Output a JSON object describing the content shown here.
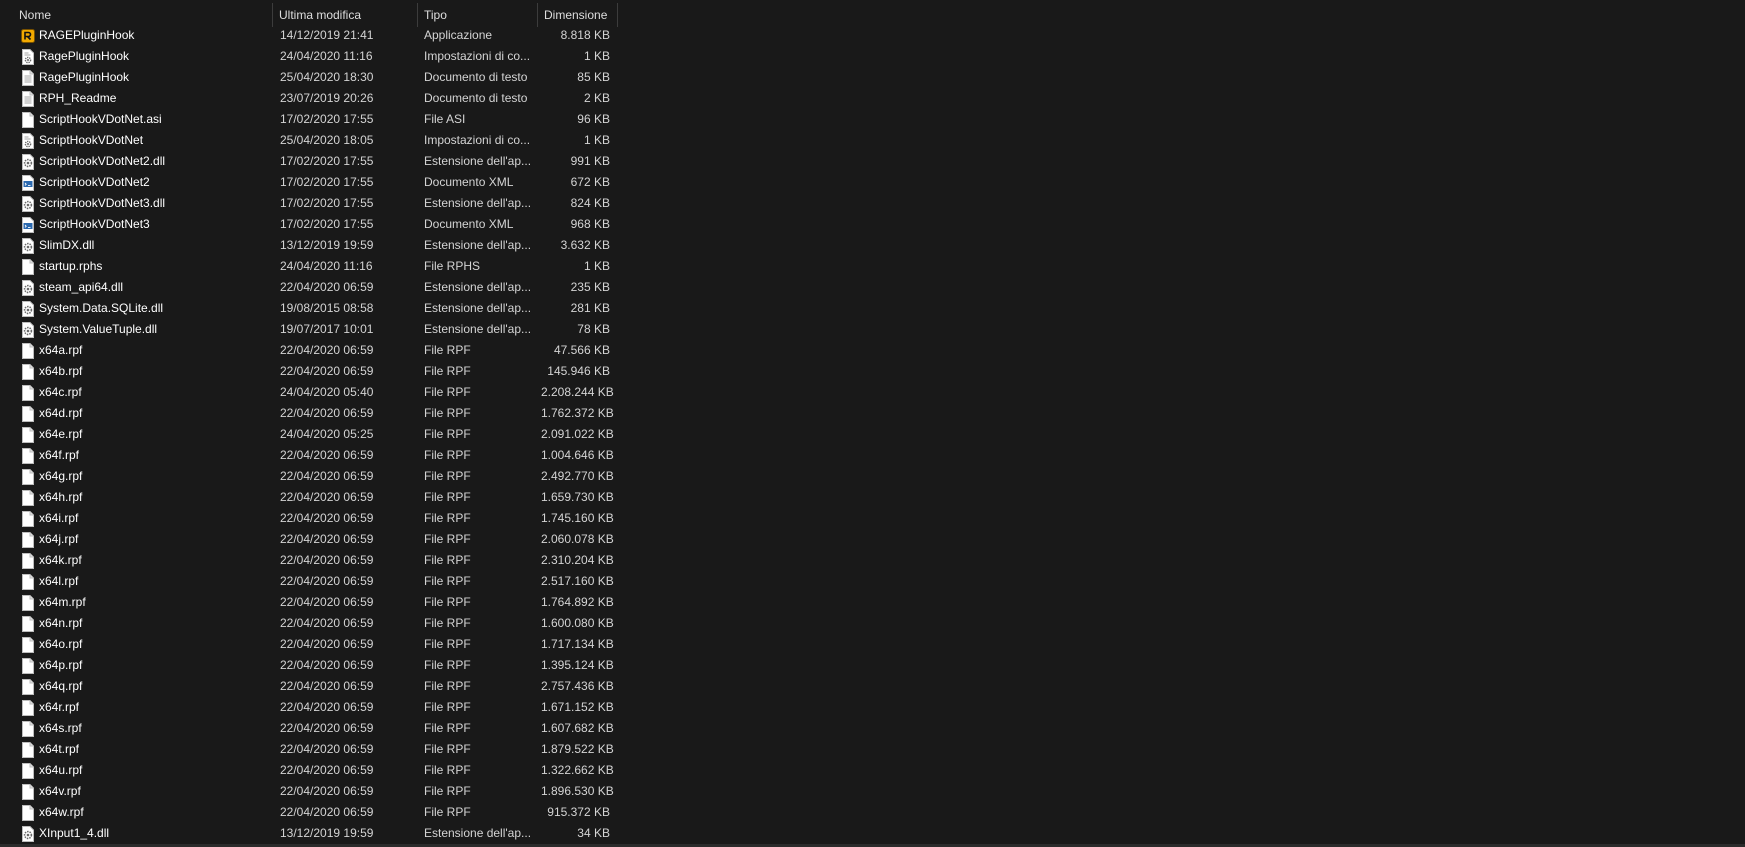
{
  "columns": {
    "name": "Nome",
    "modified": "Ultima modifica",
    "type": "Tipo",
    "size": "Dimensione"
  },
  "colors": {
    "background": "#191919",
    "text": "#ffffff",
    "divider": "#3c3c3c"
  },
  "files": [
    {
      "name": "RAGEPluginHook",
      "date": "14/12/2019 21:41",
      "type": "Applicazione",
      "size": "8.818 KB",
      "icon": "rage-app-icon"
    },
    {
      "name": "RagePluginHook",
      "date": "24/04/2020 11:16",
      "type": "Impostazioni di co...",
      "size": "1 KB",
      "icon": "settings-file-icon"
    },
    {
      "name": "RagePluginHook",
      "date": "25/04/2020 18:30",
      "type": "Documento di testo",
      "size": "85 KB",
      "icon": "text-file-icon"
    },
    {
      "name": "RPH_Readme",
      "date": "23/07/2019 20:26",
      "type": "Documento di testo",
      "size": "2 KB",
      "icon": "text-file-icon"
    },
    {
      "name": "ScriptHookVDotNet.asi",
      "date": "17/02/2020 17:55",
      "type": "File ASI",
      "size": "96 KB",
      "icon": "blank-file-icon"
    },
    {
      "name": "ScriptHookVDotNet",
      "date": "25/04/2020 18:05",
      "type": "Impostazioni di co...",
      "size": "1 KB",
      "icon": "settings-file-icon"
    },
    {
      "name": "ScriptHookVDotNet2.dll",
      "date": "17/02/2020 17:55",
      "type": "Estensione dell'ap...",
      "size": "991 KB",
      "icon": "dll-file-icon"
    },
    {
      "name": "ScriptHookVDotNet2",
      "date": "17/02/2020 17:55",
      "type": "Documento XML",
      "size": "672 KB",
      "icon": "xml-file-icon"
    },
    {
      "name": "ScriptHookVDotNet3.dll",
      "date": "17/02/2020 17:55",
      "type": "Estensione dell'ap...",
      "size": "824 KB",
      "icon": "dll-file-icon"
    },
    {
      "name": "ScriptHookVDotNet3",
      "date": "17/02/2020 17:55",
      "type": "Documento XML",
      "size": "968 KB",
      "icon": "xml-file-icon"
    },
    {
      "name": "SlimDX.dll",
      "date": "13/12/2019 19:59",
      "type": "Estensione dell'ap...",
      "size": "3.632 KB",
      "icon": "dll-file-icon"
    },
    {
      "name": "startup.rphs",
      "date": "24/04/2020 11:16",
      "type": "File RPHS",
      "size": "1 KB",
      "icon": "blank-file-icon"
    },
    {
      "name": "steam_api64.dll",
      "date": "22/04/2020 06:59",
      "type": "Estensione dell'ap...",
      "size": "235 KB",
      "icon": "dll-file-icon"
    },
    {
      "name": "System.Data.SQLite.dll",
      "date": "19/08/2015 08:58",
      "type": "Estensione dell'ap...",
      "size": "281 KB",
      "icon": "dll-file-icon"
    },
    {
      "name": "System.ValueTuple.dll",
      "date": "19/07/2017 10:01",
      "type": "Estensione dell'ap...",
      "size": "78 KB",
      "icon": "dll-file-icon"
    },
    {
      "name": "x64a.rpf",
      "date": "22/04/2020 06:59",
      "type": "File RPF",
      "size": "47.566 KB",
      "icon": "blank-file-icon"
    },
    {
      "name": "x64b.rpf",
      "date": "22/04/2020 06:59",
      "type": "File RPF",
      "size": "145.946 KB",
      "icon": "blank-file-icon"
    },
    {
      "name": "x64c.rpf",
      "date": "24/04/2020 05:40",
      "type": "File RPF",
      "size": "2.208.244 KB",
      "icon": "blank-file-icon"
    },
    {
      "name": "x64d.rpf",
      "date": "22/04/2020 06:59",
      "type": "File RPF",
      "size": "1.762.372 KB",
      "icon": "blank-file-icon"
    },
    {
      "name": "x64e.rpf",
      "date": "24/04/2020 05:25",
      "type": "File RPF",
      "size": "2.091.022 KB",
      "icon": "blank-file-icon"
    },
    {
      "name": "x64f.rpf",
      "date": "22/04/2020 06:59",
      "type": "File RPF",
      "size": "1.004.646 KB",
      "icon": "blank-file-icon"
    },
    {
      "name": "x64g.rpf",
      "date": "22/04/2020 06:59",
      "type": "File RPF",
      "size": "2.492.770 KB",
      "icon": "blank-file-icon"
    },
    {
      "name": "x64h.rpf",
      "date": "22/04/2020 06:59",
      "type": "File RPF",
      "size": "1.659.730 KB",
      "icon": "blank-file-icon"
    },
    {
      "name": "x64i.rpf",
      "date": "22/04/2020 06:59",
      "type": "File RPF",
      "size": "1.745.160 KB",
      "icon": "blank-file-icon"
    },
    {
      "name": "x64j.rpf",
      "date": "22/04/2020 06:59",
      "type": "File RPF",
      "size": "2.060.078 KB",
      "icon": "blank-file-icon"
    },
    {
      "name": "x64k.rpf",
      "date": "22/04/2020 06:59",
      "type": "File RPF",
      "size": "2.310.204 KB",
      "icon": "blank-file-icon"
    },
    {
      "name": "x64l.rpf",
      "date": "22/04/2020 06:59",
      "type": "File RPF",
      "size": "2.517.160 KB",
      "icon": "blank-file-icon"
    },
    {
      "name": "x64m.rpf",
      "date": "22/04/2020 06:59",
      "type": "File RPF",
      "size": "1.764.892 KB",
      "icon": "blank-file-icon"
    },
    {
      "name": "x64n.rpf",
      "date": "22/04/2020 06:59",
      "type": "File RPF",
      "size": "1.600.080 KB",
      "icon": "blank-file-icon"
    },
    {
      "name": "x64o.rpf",
      "date": "22/04/2020 06:59",
      "type": "File RPF",
      "size": "1.717.134 KB",
      "icon": "blank-file-icon"
    },
    {
      "name": "x64p.rpf",
      "date": "22/04/2020 06:59",
      "type": "File RPF",
      "size": "1.395.124 KB",
      "icon": "blank-file-icon"
    },
    {
      "name": "x64q.rpf",
      "date": "22/04/2020 06:59",
      "type": "File RPF",
      "size": "2.757.436 KB",
      "icon": "blank-file-icon"
    },
    {
      "name": "x64r.rpf",
      "date": "22/04/2020 06:59",
      "type": "File RPF",
      "size": "1.671.152 KB",
      "icon": "blank-file-icon"
    },
    {
      "name": "x64s.rpf",
      "date": "22/04/2020 06:59",
      "type": "File RPF",
      "size": "1.607.682 KB",
      "icon": "blank-file-icon"
    },
    {
      "name": "x64t.rpf",
      "date": "22/04/2020 06:59",
      "type": "File RPF",
      "size": "1.879.522 KB",
      "icon": "blank-file-icon"
    },
    {
      "name": "x64u.rpf",
      "date": "22/04/2020 06:59",
      "type": "File RPF",
      "size": "1.322.662 KB",
      "icon": "blank-file-icon"
    },
    {
      "name": "x64v.rpf",
      "date": "22/04/2020 06:59",
      "type": "File RPF",
      "size": "1.896.530 KB",
      "icon": "blank-file-icon"
    },
    {
      "name": "x64w.rpf",
      "date": "22/04/2020 06:59",
      "type": "File RPF",
      "size": "915.372 KB",
      "icon": "blank-file-icon"
    },
    {
      "name": "XInput1_4.dll",
      "date": "13/12/2019 19:59",
      "type": "Estensione dell'ap...",
      "size": "34 KB",
      "icon": "dll-file-icon"
    }
  ]
}
